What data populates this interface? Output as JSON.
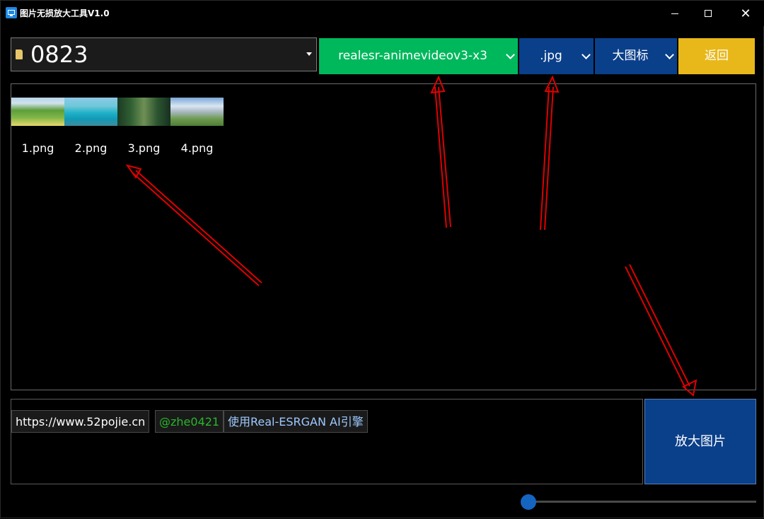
{
  "window": {
    "title": "图片无损放大工具V1.0",
    "minimize_glyph": "",
    "close_glyph": "✕"
  },
  "toolbar": {
    "folder": "0823",
    "model": "realesr-animevideov3-x3",
    "format": ".jpg",
    "view_mode": "大图标",
    "back_label": "返回",
    "colors": {
      "model": "#00b85c",
      "format": "#0a3f8a",
      "view_mode": "#0a3f8a",
      "back": "#e8b81a"
    }
  },
  "images": [
    {
      "name": "1.png"
    },
    {
      "name": "2.png"
    },
    {
      "name": "3.png"
    },
    {
      "name": "4.png"
    }
  ],
  "info": {
    "site": "https://www.52pojie.cn",
    "user": "@zhe0421",
    "engine": "使用Real-ESRGAN AI引擎"
  },
  "action": {
    "enlarge_label": "放大图片"
  },
  "slider": {
    "value_fraction": 0.0
  }
}
